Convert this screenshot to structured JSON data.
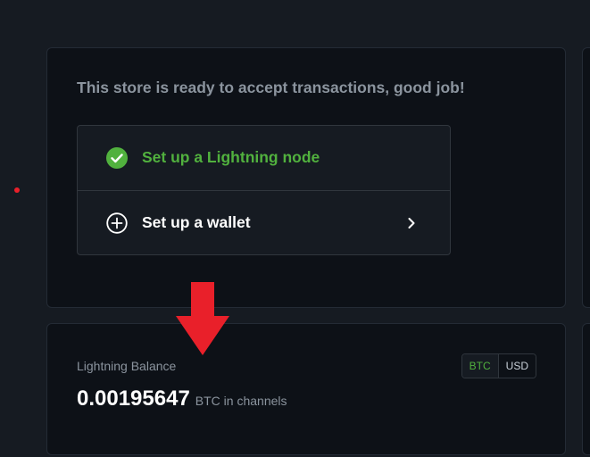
{
  "setup": {
    "heading": "This store is ready to accept transactions, good job!",
    "steps": [
      {
        "label": "Set up a Lightning node",
        "status": "done",
        "icon": "check-circle-icon"
      },
      {
        "label": "Set up a wallet",
        "status": "todo",
        "icon": "plus-circle-icon",
        "action_icon": "chevron-right-icon"
      }
    ]
  },
  "balance": {
    "label": "Lightning Balance",
    "amount": "0.00195647",
    "unit": "BTC in channels",
    "currencies": [
      "BTC",
      "USD"
    ],
    "selected_currency": "BTC"
  },
  "colors": {
    "page_bg": "#161b22",
    "card_bg": "#0d1117",
    "success": "#51b13e",
    "annotation": "#e9202a"
  }
}
